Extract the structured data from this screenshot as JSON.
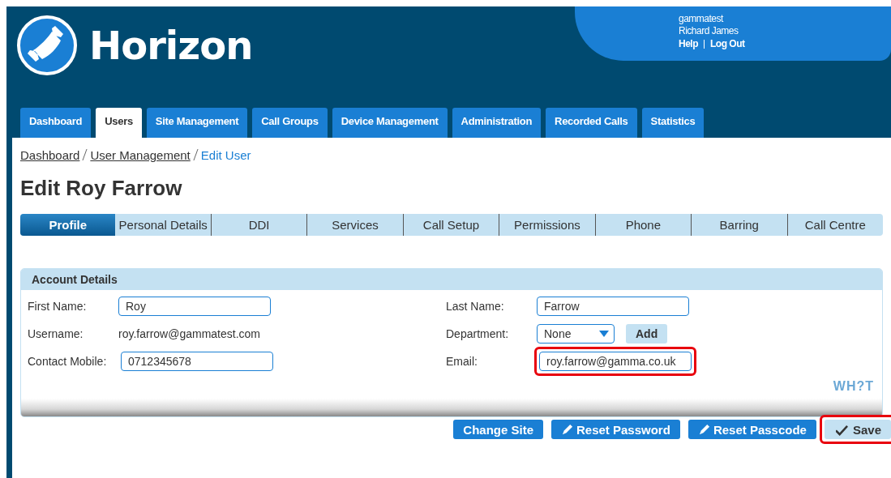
{
  "header": {
    "logo_text": "Horizon",
    "user": {
      "account": "gammatest",
      "name": "Richard James",
      "links": [
        "Help",
        "Log Out"
      ]
    }
  },
  "nav_tabs": [
    {
      "label": "Dashboard",
      "selected": false
    },
    {
      "label": "Users",
      "selected": true
    },
    {
      "label": "Site Management",
      "selected": false
    },
    {
      "label": "Call Groups",
      "selected": false
    },
    {
      "label": "Device Management",
      "selected": false
    },
    {
      "label": "Administration",
      "selected": false
    },
    {
      "label": "Recorded Calls",
      "selected": false
    },
    {
      "label": "Statistics",
      "selected": false
    }
  ],
  "breadcrumb": [
    {
      "label": "Dashboard",
      "kind": "link"
    },
    {
      "label": "User Management",
      "kind": "link"
    },
    {
      "label": "Edit User",
      "kind": "current"
    }
  ],
  "title": "Edit Roy Farrow",
  "sub_tabs": [
    {
      "label": "Profile",
      "selected": true
    },
    {
      "label": "Personal Details",
      "selected": false
    },
    {
      "label": "DDI",
      "selected": false
    },
    {
      "label": "Services",
      "selected": false
    },
    {
      "label": "Call Setup",
      "selected": false
    },
    {
      "label": "Permissions",
      "selected": false
    },
    {
      "label": "Phone",
      "selected": false
    },
    {
      "label": "Barring",
      "selected": false
    },
    {
      "label": "Call Centre",
      "selected": false
    }
  ],
  "account_details": {
    "heading": "Account Details",
    "left_fields": [
      {
        "label": "First Name:",
        "kind": "input",
        "value": "Roy",
        "highlighted": false
      },
      {
        "label": "Username:",
        "kind": "text",
        "value": "roy.farrow@gammatest.com",
        "highlighted": false
      },
      {
        "label": "Contact Mobile:",
        "kind": "input",
        "value": "0712345678",
        "highlighted": false
      }
    ],
    "right_fields": [
      {
        "label": "Last Name:",
        "kind": "input",
        "value": "Farrow",
        "highlighted": false
      },
      {
        "label": "Department:",
        "kind": "select",
        "value": "None",
        "button": "Add",
        "highlighted": false
      },
      {
        "label": "Email:",
        "kind": "input",
        "value": "roy.farrow@gamma.co.uk",
        "highlighted": true
      }
    ],
    "brand": "WH?T"
  },
  "actions": [
    {
      "label": "Change Site",
      "kind": "plain",
      "highlighted": false
    },
    {
      "label": "Reset Password",
      "kind": "pencil",
      "highlighted": false
    },
    {
      "label": "Reset Passcode",
      "kind": "pencil",
      "highlighted": false
    },
    {
      "label": "Save",
      "kind": "save",
      "highlighted": true
    }
  ]
}
